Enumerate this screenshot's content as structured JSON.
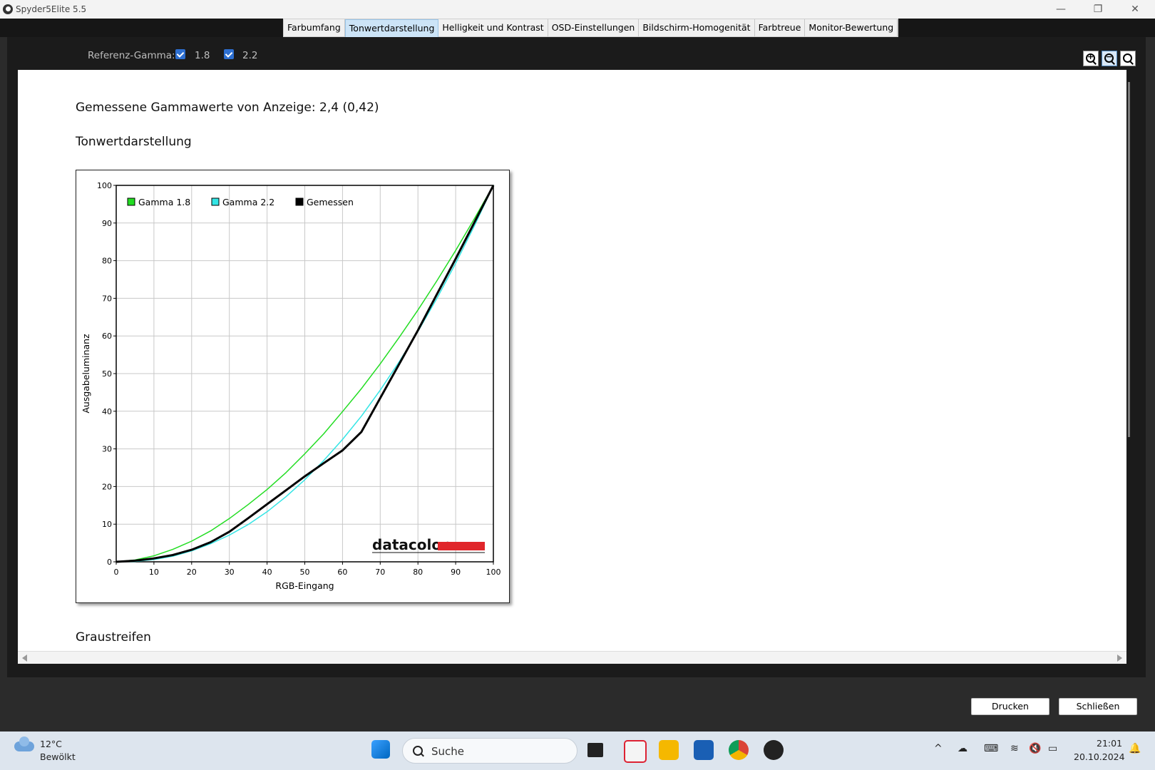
{
  "window": {
    "title": "Spyder5Elite 5.5"
  },
  "tabs": [
    {
      "label": "Farbumfang",
      "active": false
    },
    {
      "label": "Tonwertdarstellung",
      "active": true
    },
    {
      "label": "Helligkeit und Kontrast",
      "active": false
    },
    {
      "label": "OSD-Einstellungen",
      "active": false
    },
    {
      "label": "Bildschirm-Homogenität",
      "active": false
    },
    {
      "label": "Farbtreue",
      "active": false
    },
    {
      "label": "Monitor-Bewertung",
      "active": false
    }
  ],
  "toolbar": {
    "ref_gamma_label": "Referenz-Gamma:",
    "gamma_options": [
      {
        "label": "1.8",
        "checked": true
      },
      {
        "label": "2.2",
        "checked": true
      }
    ]
  },
  "report": {
    "measured_text": "Gemessene Gammawerte von Anzeige: 2,4 (0,42)",
    "section_title": "Tonwertdarstellung",
    "next_section": "Graustreifen",
    "logo_text": "datacolor"
  },
  "chart_data": {
    "type": "line",
    "xlabel": "RGB-Eingang",
    "ylabel": "Ausgabeluminanz",
    "xlim": [
      0,
      100
    ],
    "ylim": [
      0,
      100
    ],
    "xticks": [
      0,
      10,
      20,
      30,
      40,
      50,
      60,
      70,
      80,
      90,
      100
    ],
    "yticks": [
      0,
      10,
      20,
      30,
      40,
      50,
      60,
      70,
      80,
      90,
      100
    ],
    "grid": true,
    "legend_position": "top-left",
    "x": [
      0,
      5,
      10,
      15,
      20,
      25,
      30,
      35,
      40,
      45,
      50,
      55,
      60,
      65,
      70,
      75,
      80,
      85,
      90,
      95,
      100
    ],
    "series": [
      {
        "name": "Gamma 1.8",
        "color": "#22dd22",
        "values": [
          0,
          0.5,
          1.6,
          3.3,
          5.5,
          8.2,
          11.5,
          15.2,
          19.2,
          23.7,
          28.7,
          34,
          39.9,
          46,
          52.6,
          59.6,
          66.9,
          74.6,
          82.7,
          91.2,
          100
        ]
      },
      {
        "name": "Gamma 2.2",
        "color": "#33e5e5",
        "values": [
          0,
          0.1,
          0.6,
          1.5,
          2.9,
          4.8,
          7.1,
          9.9,
          13.3,
          17.3,
          21.8,
          26.9,
          32.5,
          38.7,
          45.6,
          53.1,
          61.2,
          69.9,
          79.3,
          89.3,
          100
        ]
      },
      {
        "name": "Gemessen",
        "color": "#000000",
        "values": [
          0,
          0.3,
          0.9,
          1.8,
          3.2,
          5.2,
          8,
          11.6,
          15.3,
          19,
          22.7,
          26.2,
          29.6,
          34.5,
          43.5,
          52.5,
          61.5,
          71,
          80.5,
          90.2,
          100
        ]
      }
    ]
  },
  "footer": {
    "print_label": "Drucken",
    "close_label": "Schließen"
  },
  "taskbar": {
    "temp": "12°C",
    "condition": "Bewölkt",
    "search_placeholder": "Suche",
    "time": "21:01",
    "date": "20.10.2024"
  }
}
